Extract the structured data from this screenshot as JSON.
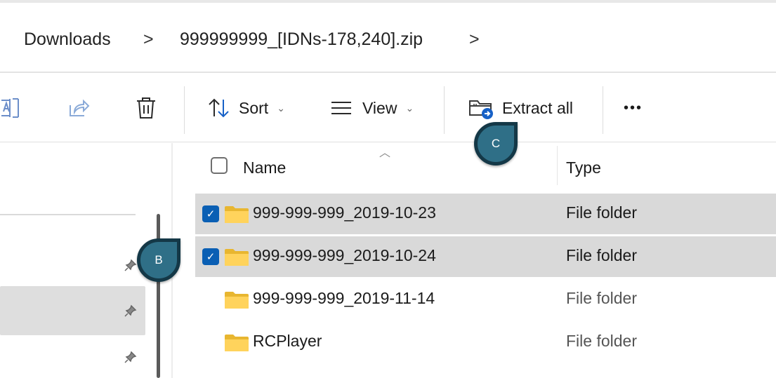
{
  "breadcrumb": {
    "items": [
      "Downloads",
      "999999999_[IDNs-178,240].zip"
    ],
    "separator": ">"
  },
  "toolbar": {
    "sort_label": "Sort",
    "view_label": "View",
    "extract_label": "Extract all",
    "more_label": "•••",
    "chevron": "⌄"
  },
  "file_list": {
    "columns": {
      "name": "Name",
      "type": "Type"
    },
    "rows": [
      {
        "name": "999-999-999_2019-10-23",
        "type": "File folder",
        "selected": true,
        "checked": true
      },
      {
        "name": "999-999-999_2019-10-24",
        "type": "File folder",
        "selected": true,
        "checked": true
      },
      {
        "name": "999-999-999_2019-11-14",
        "type": "File folder",
        "selected": false,
        "checked": false
      },
      {
        "name": "RCPlayer",
        "type": "File folder",
        "selected": false,
        "checked": false
      }
    ]
  },
  "callouts": {
    "b": "B",
    "c": "C"
  },
  "colors": {
    "accent": "#0a5fb4",
    "marker_fill": "#2f6f87",
    "marker_border": "#143847",
    "folder": "#f4c542",
    "selection": "#d9d9d9"
  },
  "icons": [
    "rename-icon",
    "share-icon",
    "delete-icon",
    "sort-icon",
    "view-icon",
    "extract-folder-icon",
    "more-icon",
    "pin-icon",
    "folder-icon",
    "checkbox-icon"
  ]
}
